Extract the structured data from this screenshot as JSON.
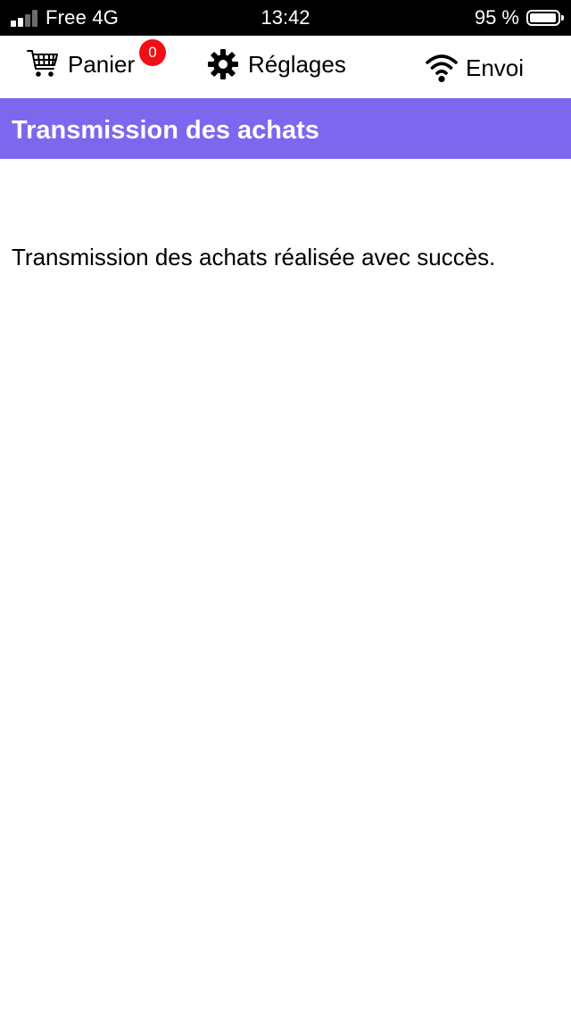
{
  "status_bar": {
    "carrier": "Free 4G",
    "time": "13:42",
    "battery": "95 %",
    "battery_level": 0.95
  },
  "nav": {
    "panier": {
      "label": "Panier",
      "badge": "0",
      "icon": "cart-icon"
    },
    "reglages": {
      "label": "Réglages",
      "icon": "gear-icon"
    },
    "envoi": {
      "label": "Envoi",
      "icon": "wifi-icon"
    }
  },
  "header": {
    "title": "Transmission des achats",
    "color": "#7b68ee"
  },
  "content": {
    "message": "Transmission des achats réalisée avec succès."
  },
  "colors": {
    "badge": "#f00f16"
  }
}
